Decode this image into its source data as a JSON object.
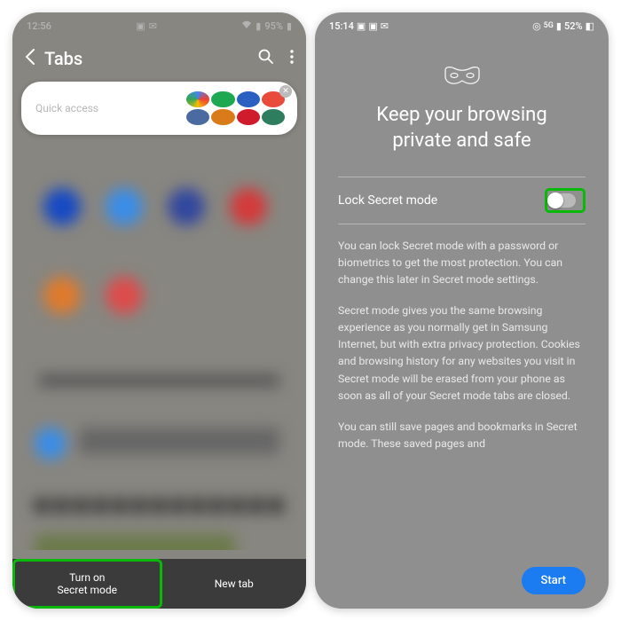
{
  "left": {
    "status": {
      "time": "12:56",
      "battery": "95%"
    },
    "header": {
      "title": "Tabs"
    },
    "tab_card_label": "Quick access",
    "bottom": {
      "secret": "Turn on\nSecret mode",
      "newtab": "New tab"
    }
  },
  "right": {
    "status": {
      "time": "15:14",
      "battery": "52%"
    },
    "heading": "Keep your browsing private and safe",
    "lock_label": "Lock Secret mode",
    "para1": "You can lock Secret mode with a password or biometrics to get the most protection. You can change this later in Secret mode settings.",
    "para2": "Secret mode gives you the same browsing experience as you normally get in Samsung Internet, but with extra privacy protection. Cookies and browsing history for any websites you visit in Secret mode will be erased from your phone as soon as all of your Secret mode tabs are closed.",
    "para3": "You can still save pages and bookmarks in Secret mode. These saved pages and",
    "start": "Start"
  }
}
